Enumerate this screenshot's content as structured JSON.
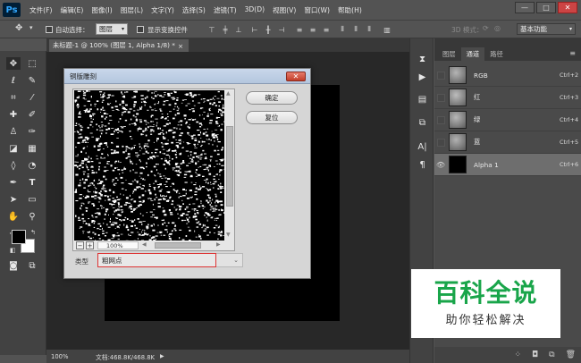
{
  "app": {
    "logo": "Ps"
  },
  "menu": [
    "文件(F)",
    "编辑(E)",
    "图像(I)",
    "图层(L)",
    "文字(Y)",
    "选择(S)",
    "滤镜(T)",
    "3D(D)",
    "视图(V)",
    "窗口(W)",
    "帮助(H)"
  ],
  "window_controls": {
    "minimize": "—",
    "restore": "□",
    "close": "✕"
  },
  "options": {
    "auto_select_label": "自动选择：",
    "auto_select_value": "图层",
    "show_transform_label": "显示变换控件",
    "mode_3d_label": "3D 模式：",
    "workspace": "基本功能"
  },
  "document": {
    "tab_title": "未标题-1 @ 100% (图层 1, Alpha 1/8) *",
    "tab_close": "×",
    "zoom": "100%",
    "doc_size": "文档:468.8K/468.8K"
  },
  "dialog": {
    "title": "铜版雕刻",
    "close": "✕",
    "ok_label": "确定",
    "reset_label": "复位",
    "zoom_minus": "−",
    "zoom_plus": "+",
    "preview_zoom": "100%",
    "type_label": "类型",
    "type_value": "粗网点"
  },
  "panel": {
    "tabs": [
      "图层",
      "通道",
      "路径"
    ],
    "active_tab": 1,
    "channels": [
      {
        "name": "RGB",
        "shortcut": "Ctrl+2",
        "thumb": "#8a8a8a",
        "visible": false
      },
      {
        "name": "红",
        "shortcut": "Ctrl+3",
        "thumb": "#8f8f8f",
        "visible": false
      },
      {
        "name": "绿",
        "shortcut": "Ctrl+4",
        "thumb": "#8c8c8c",
        "visible": false
      },
      {
        "name": "蓝",
        "shortcut": "Ctrl+5",
        "thumb": "#888888",
        "visible": false
      },
      {
        "name": "Alpha 1",
        "shortcut": "Ctrl+6",
        "thumb": "#000000",
        "visible": true,
        "selected": true
      }
    ]
  },
  "watermark": {
    "main": "百科全说",
    "sub": "助你轻松解决",
    "color": "#19a54a"
  }
}
